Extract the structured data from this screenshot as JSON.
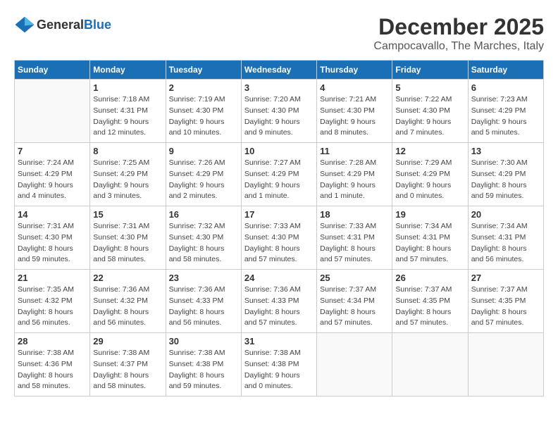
{
  "header": {
    "logo_general": "General",
    "logo_blue": "Blue",
    "month": "December 2025",
    "location": "Campocavallo, The Marches, Italy"
  },
  "weekdays": [
    "Sunday",
    "Monday",
    "Tuesday",
    "Wednesday",
    "Thursday",
    "Friday",
    "Saturday"
  ],
  "weeks": [
    [
      {
        "day": "",
        "sunrise": "",
        "sunset": "",
        "daylight": ""
      },
      {
        "day": "1",
        "sunrise": "Sunrise: 7:18 AM",
        "sunset": "Sunset: 4:31 PM",
        "daylight": "Daylight: 9 hours and 12 minutes."
      },
      {
        "day": "2",
        "sunrise": "Sunrise: 7:19 AM",
        "sunset": "Sunset: 4:30 PM",
        "daylight": "Daylight: 9 hours and 10 minutes."
      },
      {
        "day": "3",
        "sunrise": "Sunrise: 7:20 AM",
        "sunset": "Sunset: 4:30 PM",
        "daylight": "Daylight: 9 hours and 9 minutes."
      },
      {
        "day": "4",
        "sunrise": "Sunrise: 7:21 AM",
        "sunset": "Sunset: 4:30 PM",
        "daylight": "Daylight: 9 hours and 8 minutes."
      },
      {
        "day": "5",
        "sunrise": "Sunrise: 7:22 AM",
        "sunset": "Sunset: 4:30 PM",
        "daylight": "Daylight: 9 hours and 7 minutes."
      },
      {
        "day": "6",
        "sunrise": "Sunrise: 7:23 AM",
        "sunset": "Sunset: 4:29 PM",
        "daylight": "Daylight: 9 hours and 5 minutes."
      }
    ],
    [
      {
        "day": "7",
        "sunrise": "Sunrise: 7:24 AM",
        "sunset": "Sunset: 4:29 PM",
        "daylight": "Daylight: 9 hours and 4 minutes."
      },
      {
        "day": "8",
        "sunrise": "Sunrise: 7:25 AM",
        "sunset": "Sunset: 4:29 PM",
        "daylight": "Daylight: 9 hours and 3 minutes."
      },
      {
        "day": "9",
        "sunrise": "Sunrise: 7:26 AM",
        "sunset": "Sunset: 4:29 PM",
        "daylight": "Daylight: 9 hours and 2 minutes."
      },
      {
        "day": "10",
        "sunrise": "Sunrise: 7:27 AM",
        "sunset": "Sunset: 4:29 PM",
        "daylight": "Daylight: 9 hours and 1 minute."
      },
      {
        "day": "11",
        "sunrise": "Sunrise: 7:28 AM",
        "sunset": "Sunset: 4:29 PM",
        "daylight": "Daylight: 9 hours and 1 minute."
      },
      {
        "day": "12",
        "sunrise": "Sunrise: 7:29 AM",
        "sunset": "Sunset: 4:29 PM",
        "daylight": "Daylight: 9 hours and 0 minutes."
      },
      {
        "day": "13",
        "sunrise": "Sunrise: 7:30 AM",
        "sunset": "Sunset: 4:29 PM",
        "daylight": "Daylight: 8 hours and 59 minutes."
      }
    ],
    [
      {
        "day": "14",
        "sunrise": "Sunrise: 7:31 AM",
        "sunset": "Sunset: 4:30 PM",
        "daylight": "Daylight: 8 hours and 59 minutes."
      },
      {
        "day": "15",
        "sunrise": "Sunrise: 7:31 AM",
        "sunset": "Sunset: 4:30 PM",
        "daylight": "Daylight: 8 hours and 58 minutes."
      },
      {
        "day": "16",
        "sunrise": "Sunrise: 7:32 AM",
        "sunset": "Sunset: 4:30 PM",
        "daylight": "Daylight: 8 hours and 58 minutes."
      },
      {
        "day": "17",
        "sunrise": "Sunrise: 7:33 AM",
        "sunset": "Sunset: 4:30 PM",
        "daylight": "Daylight: 8 hours and 57 minutes."
      },
      {
        "day": "18",
        "sunrise": "Sunrise: 7:33 AM",
        "sunset": "Sunset: 4:31 PM",
        "daylight": "Daylight: 8 hours and 57 minutes."
      },
      {
        "day": "19",
        "sunrise": "Sunrise: 7:34 AM",
        "sunset": "Sunset: 4:31 PM",
        "daylight": "Daylight: 8 hours and 57 minutes."
      },
      {
        "day": "20",
        "sunrise": "Sunrise: 7:34 AM",
        "sunset": "Sunset: 4:31 PM",
        "daylight": "Daylight: 8 hours and 56 minutes."
      }
    ],
    [
      {
        "day": "21",
        "sunrise": "Sunrise: 7:35 AM",
        "sunset": "Sunset: 4:32 PM",
        "daylight": "Daylight: 8 hours and 56 minutes."
      },
      {
        "day": "22",
        "sunrise": "Sunrise: 7:36 AM",
        "sunset": "Sunset: 4:32 PM",
        "daylight": "Daylight: 8 hours and 56 minutes."
      },
      {
        "day": "23",
        "sunrise": "Sunrise: 7:36 AM",
        "sunset": "Sunset: 4:33 PM",
        "daylight": "Daylight: 8 hours and 56 minutes."
      },
      {
        "day": "24",
        "sunrise": "Sunrise: 7:36 AM",
        "sunset": "Sunset: 4:33 PM",
        "daylight": "Daylight: 8 hours and 57 minutes."
      },
      {
        "day": "25",
        "sunrise": "Sunrise: 7:37 AM",
        "sunset": "Sunset: 4:34 PM",
        "daylight": "Daylight: 8 hours and 57 minutes."
      },
      {
        "day": "26",
        "sunrise": "Sunrise: 7:37 AM",
        "sunset": "Sunset: 4:35 PM",
        "daylight": "Daylight: 8 hours and 57 minutes."
      },
      {
        "day": "27",
        "sunrise": "Sunrise: 7:37 AM",
        "sunset": "Sunset: 4:35 PM",
        "daylight": "Daylight: 8 hours and 57 minutes."
      }
    ],
    [
      {
        "day": "28",
        "sunrise": "Sunrise: 7:38 AM",
        "sunset": "Sunset: 4:36 PM",
        "daylight": "Daylight: 8 hours and 58 minutes."
      },
      {
        "day": "29",
        "sunrise": "Sunrise: 7:38 AM",
        "sunset": "Sunset: 4:37 PM",
        "daylight": "Daylight: 8 hours and 58 minutes."
      },
      {
        "day": "30",
        "sunrise": "Sunrise: 7:38 AM",
        "sunset": "Sunset: 4:38 PM",
        "daylight": "Daylight: 8 hours and 59 minutes."
      },
      {
        "day": "31",
        "sunrise": "Sunrise: 7:38 AM",
        "sunset": "Sunset: 4:38 PM",
        "daylight": "Daylight: 9 hours and 0 minutes."
      },
      {
        "day": "",
        "sunrise": "",
        "sunset": "",
        "daylight": ""
      },
      {
        "day": "",
        "sunrise": "",
        "sunset": "",
        "daylight": ""
      },
      {
        "day": "",
        "sunrise": "",
        "sunset": "",
        "daylight": ""
      }
    ]
  ]
}
